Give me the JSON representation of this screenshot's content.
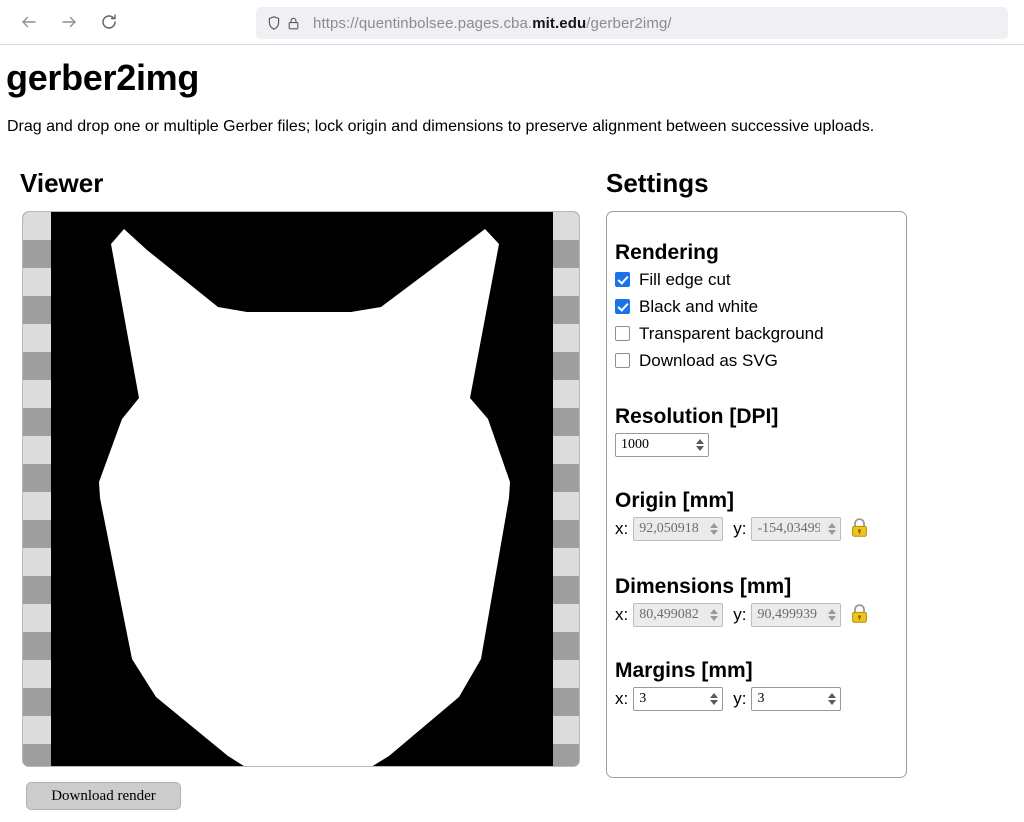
{
  "browser": {
    "back_icon": "arrow-left-icon",
    "forward_icon": "arrow-right-icon",
    "reload_icon": "reload-icon",
    "shield_icon": "shield-icon",
    "lock_icon": "padlock-icon",
    "url_prefix": "https://quentinbolsee.pages.cba.",
    "url_domain": "mit.edu",
    "url_suffix": "/gerber2img/",
    "url_full": "https://quentinbolsee.pages.cba.mit.edu/gerber2img/"
  },
  "page": {
    "title": "gerber2img",
    "description": "Drag and drop one or multiple Gerber files; lock origin and dimensions to preserve alignment between successive uploads."
  },
  "viewer": {
    "heading": "Viewer",
    "download_label": "Download render",
    "background_color": "#000000",
    "shape_color": "#ffffff",
    "checker_light": "#dcdcdc",
    "checker_dark": "#9e9e9e"
  },
  "settings": {
    "heading": "Settings",
    "rendering": {
      "title": "Rendering",
      "options": [
        {
          "label": "Fill edge cut",
          "checked": true
        },
        {
          "label": "Black and white",
          "checked": true
        },
        {
          "label": "Transparent background",
          "checked": false
        },
        {
          "label": "Download as SVG",
          "checked": false
        }
      ],
      "accent_color": "#1a73e8"
    },
    "resolution": {
      "title": "Resolution [DPI]",
      "value": "1000",
      "disabled": false
    },
    "origin": {
      "title": "Origin [mm]",
      "x_label": "x:",
      "x_value": "92,050918",
      "y_label": "y:",
      "y_value": "-154,03499",
      "locked": true,
      "lock_icon": "padlock-locked-icon",
      "disabled": true
    },
    "dimensions": {
      "title": "Dimensions [mm]",
      "x_label": "x:",
      "x_value": "80,499082",
      "y_label": "y:",
      "y_value": "90,499939",
      "locked": true,
      "lock_icon": "padlock-locked-icon",
      "disabled": true
    },
    "margins": {
      "title": "Margins [mm]",
      "x_label": "x:",
      "x_value": "3",
      "y_label": "y:",
      "y_value": "3",
      "disabled": false
    }
  }
}
